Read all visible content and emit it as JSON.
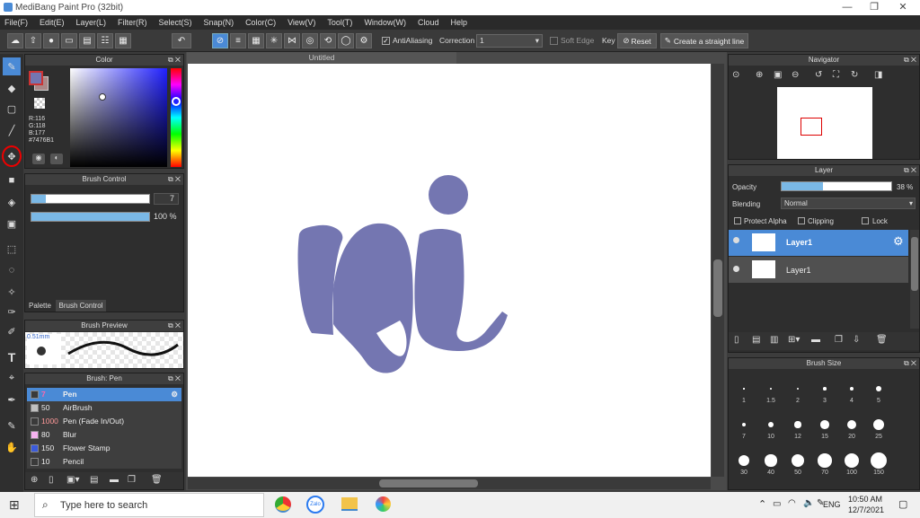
{
  "app": {
    "title": "MediBang Paint Pro (32bit)"
  },
  "menu": [
    "File(F)",
    "Edit(E)",
    "Layer(L)",
    "Filter(R)",
    "Select(S)",
    "Snap(N)",
    "Color(C)",
    "View(V)",
    "Tool(T)",
    "Window(W)",
    "Cloud",
    "Help"
  ],
  "toolbar": {
    "antialias": "AntiAliasing",
    "correction_label": "Correction",
    "correction_value": "1",
    "soft_edge": "Soft Edge",
    "key": "Key",
    "reset": "Reset",
    "straight_line": "Create a straight line"
  },
  "color_panel": {
    "title": "Color",
    "r": "R:116",
    "g": "G:118",
    "b": "B:177",
    "hex": "#7476B1",
    "main_color": "#7476b1"
  },
  "brush_control": {
    "title": "Brush Control",
    "size": "7",
    "opacity": "100 %"
  },
  "tabs": {
    "palette": "Palette",
    "brush_control": "Brush Control"
  },
  "brush_preview": {
    "title": "Brush Preview",
    "size": "0.51mm"
  },
  "brush_list": {
    "title": "Brush: Pen",
    "items": [
      {
        "size": "7",
        "name": "Pen",
        "color": "#3a3a3a",
        "selected": true
      },
      {
        "size": "50",
        "name": "AirBrush",
        "color": "#c0c0c0",
        "selected": false
      },
      {
        "size": "1000",
        "name": "Pen (Fade In/Out)",
        "color": "#3a3a3a",
        "selected": false
      },
      {
        "size": "80",
        "name": "Blur",
        "color": "#f6b3f0",
        "selected": false
      },
      {
        "size": "150",
        "name": "Flower Stamp",
        "color": "#3b5bdb",
        "selected": false
      },
      {
        "size": "10",
        "name": "Pencil",
        "color": "#3a3a3a",
        "selected": false
      }
    ]
  },
  "canvas": {
    "tab": "Untitled",
    "stroke_color": "#7476b1"
  },
  "navigator": {
    "title": "Navigator"
  },
  "layer_panel": {
    "title": "Layer",
    "opacity_label": "Opacity",
    "opacity_value": "38 %",
    "opacity_fraction": 0.38,
    "blending_label": "Blending",
    "blending_value": "Normal",
    "protect_alpha": "Protect Alpha",
    "clipping": "Clipping",
    "lock": "Lock",
    "layers": [
      {
        "name": "Layer1",
        "selected": true
      },
      {
        "name": "Layer1",
        "selected": false
      }
    ]
  },
  "brush_size": {
    "title": "Brush Size",
    "sizes": [
      "1",
      "1.5",
      "2",
      "3",
      "4",
      "5",
      "7",
      "10",
      "12",
      "15",
      "20",
      "25",
      "30",
      "40",
      "50",
      "70",
      "100",
      "150"
    ]
  },
  "taskbar": {
    "search_placeholder": "Type here to search",
    "time": "10:50 AM",
    "date": "12/7/2021",
    "lang": "ENG"
  }
}
